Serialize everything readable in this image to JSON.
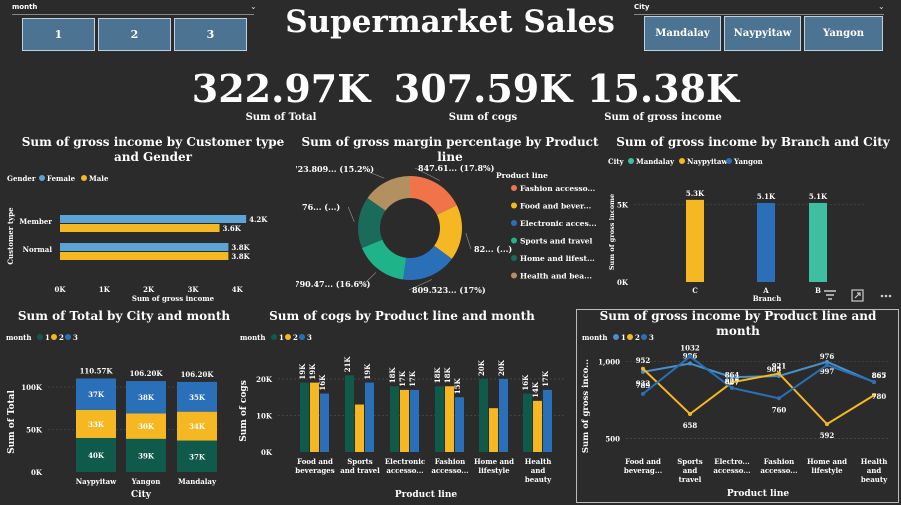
{
  "month_slicer": {
    "title": "month",
    "items": [
      "1",
      "2",
      "3"
    ]
  },
  "city_slicer": {
    "title": "City",
    "items": [
      "Mandalay",
      "Naypyitaw",
      "Yangon"
    ]
  },
  "title": "Supermarket Sales",
  "kpis": [
    {
      "value": "322.97K",
      "label": "Sum of Total"
    },
    {
      "value": "307.59K",
      "label": "Sum of cogs"
    },
    {
      "value": "15.38K",
      "label": "Sum of gross income"
    }
  ],
  "colors": {
    "background": "#2b2b2b",
    "female": "#5da4d6",
    "male": "#f5b823",
    "month1": "#0f5a4b",
    "month2": "#f5b823",
    "month3": "#2a70b8",
    "mandalay": "#3dbfa0",
    "naypyitaw": "#f5b823",
    "yangon": "#2a70b8"
  },
  "icons": [
    "filter-icon",
    "focus-mode-icon",
    "more-options-icon",
    "chevron-down-icon"
  ],
  "chart_data": [
    {
      "id": "c1",
      "type": "bar",
      "orientation": "horizontal",
      "title": "Sum of gross income by Customer type and Gender",
      "legend_title": "Gender",
      "categories": [
        "Member",
        "Normal"
      ],
      "series": [
        {
          "name": "Female",
          "values": [
            4.2,
            3.8
          ],
          "labels": [
            "4.2K",
            "3.8K"
          ]
        },
        {
          "name": "Male",
          "values": [
            3.6,
            3.8
          ],
          "labels": [
            "3.6K",
            "3.8K"
          ]
        }
      ],
      "xlabel": "Sum of gross income",
      "ylabel": "Customer type",
      "xticks": [
        "0K",
        "1K",
        "2K",
        "3K",
        "4K"
      ],
      "xlim": [
        0,
        4.4
      ]
    },
    {
      "id": "c2",
      "type": "pie",
      "donut": true,
      "title": "Sum of gross margin percentage by Product line",
      "legend_title": "Product line",
      "slices": [
        {
          "name": "Fashion accesso...",
          "value": 17.8,
          "label": "847.61... (17.8%)",
          "color": "#f0734a"
        },
        {
          "name": "Food and bever...",
          "value": 17.3,
          "label": "82... (...)",
          "color": "#f5b823"
        },
        {
          "name": "Electronic acces...",
          "value": 17.0,
          "label": "809.523... (17%)",
          "color": "#2a70b8"
        },
        {
          "name": "Sports and travel",
          "value": 16.6,
          "label": "790.47... (16.6%)",
          "color": "#1fb38a"
        },
        {
          "name": "Home and lifest...",
          "value": 16.1,
          "label": "76... (...)",
          "color": "#1a6b5a"
        },
        {
          "name": "Health and bea...",
          "value": 15.2,
          "label": "723.809... (15.2%)",
          "color": "#b39060"
        }
      ]
    },
    {
      "id": "c3",
      "type": "bar",
      "title": "Sum of gross income by Branch and City",
      "legend_title": "City",
      "legend": [
        "Mandalay",
        "Naypyitaw",
        "Yangon"
      ],
      "categories": [
        "C",
        "A",
        "B"
      ],
      "bars": [
        {
          "category": "C",
          "city": "Naypyitaw",
          "value": 5.3,
          "label": "5.3K"
        },
        {
          "category": "A",
          "city": "Yangon",
          "value": 5.1,
          "label": "5.1K"
        },
        {
          "category": "B",
          "city": "Mandalay",
          "value": 5.1,
          "label": "5.1K"
        }
      ],
      "xlabel": "Branch",
      "ylabel": "Sum of gross income",
      "yticks": [
        "0K",
        "5K"
      ],
      "ylim": [
        0,
        6
      ]
    },
    {
      "id": "c4",
      "type": "bar",
      "stacked": true,
      "title": "Sum of Total by City and month",
      "legend_title": "month",
      "categories": [
        "Naypyitaw",
        "Yangon",
        "Mandalay"
      ],
      "series": [
        {
          "name": "1",
          "values": [
            40,
            39,
            37
          ],
          "labels": [
            "40K",
            "39K",
            "37K"
          ]
        },
        {
          "name": "2",
          "values": [
            33,
            30,
            34
          ],
          "labels": [
            "33K",
            "30K",
            "34K"
          ]
        },
        {
          "name": "3",
          "values": [
            37,
            38,
            35
          ],
          "labels": [
            "37K",
            "38K",
            "35K"
          ]
        }
      ],
      "totals": [
        "110.57K",
        "106.20K",
        "106.20K"
      ],
      "xlabel": "City",
      "ylabel": "Sum of Total",
      "yticks": [
        "0K",
        "50K",
        "100K"
      ],
      "ylim": [
        0,
        120
      ]
    },
    {
      "id": "c5",
      "type": "bar",
      "title": "Sum of cogs by Product line and month",
      "legend_title": "month",
      "categories": [
        "Food and beverages",
        "Sports and travel",
        "Electronic accesso...",
        "Fashion accesso...",
        "Home and lifestyle",
        "Health and beauty"
      ],
      "series": [
        {
          "name": "1",
          "values": [
            19,
            21,
            18,
            18,
            20,
            16
          ],
          "labels": [
            "19K",
            "21K",
            "18K",
            "18K",
            "20K",
            "16K"
          ]
        },
        {
          "name": "2",
          "values": [
            19,
            13,
            17,
            18,
            12,
            14
          ],
          "labels": [
            "19K",
            "",
            "17K",
            "18K",
            "",
            "14K"
          ]
        },
        {
          "name": "3",
          "values": [
            16,
            19,
            17,
            15,
            20,
            17
          ],
          "labels": [
            "16K",
            "19K",
            "17K",
            "15K",
            "20K",
            "17K"
          ]
        }
      ],
      "xlabel": "Product line",
      "ylabel": "Sum of cogs",
      "yticks": [
        "0K",
        "10K",
        "20K"
      ],
      "ylim": [
        0,
        23
      ]
    },
    {
      "id": "c6",
      "type": "line",
      "title": "Sum of gross income by Product line and month",
      "legend_title": "month",
      "categories": [
        "Food and beverag...",
        "Sports and travel",
        "Electro... accesso...",
        "Fashion accesso...",
        "Home and lifestyle",
        "Health and beauty"
      ],
      "series": [
        {
          "name": "1",
          "values": [
            932,
            986,
            897,
            905,
            997,
            865
          ]
        },
        {
          "name": "2",
          "values": [
            952,
            658,
            864,
            921,
            592,
            780
          ]
        },
        {
          "name": "3",
          "values": [
            789,
            1032,
            827,
            760,
            976,
            867
          ]
        }
      ],
      "xlabel": "Product line",
      "ylabel": "Sum of gross inco...",
      "yticks": [
        "500",
        "1,000"
      ],
      "ylim": [
        450,
        1100
      ]
    }
  ]
}
